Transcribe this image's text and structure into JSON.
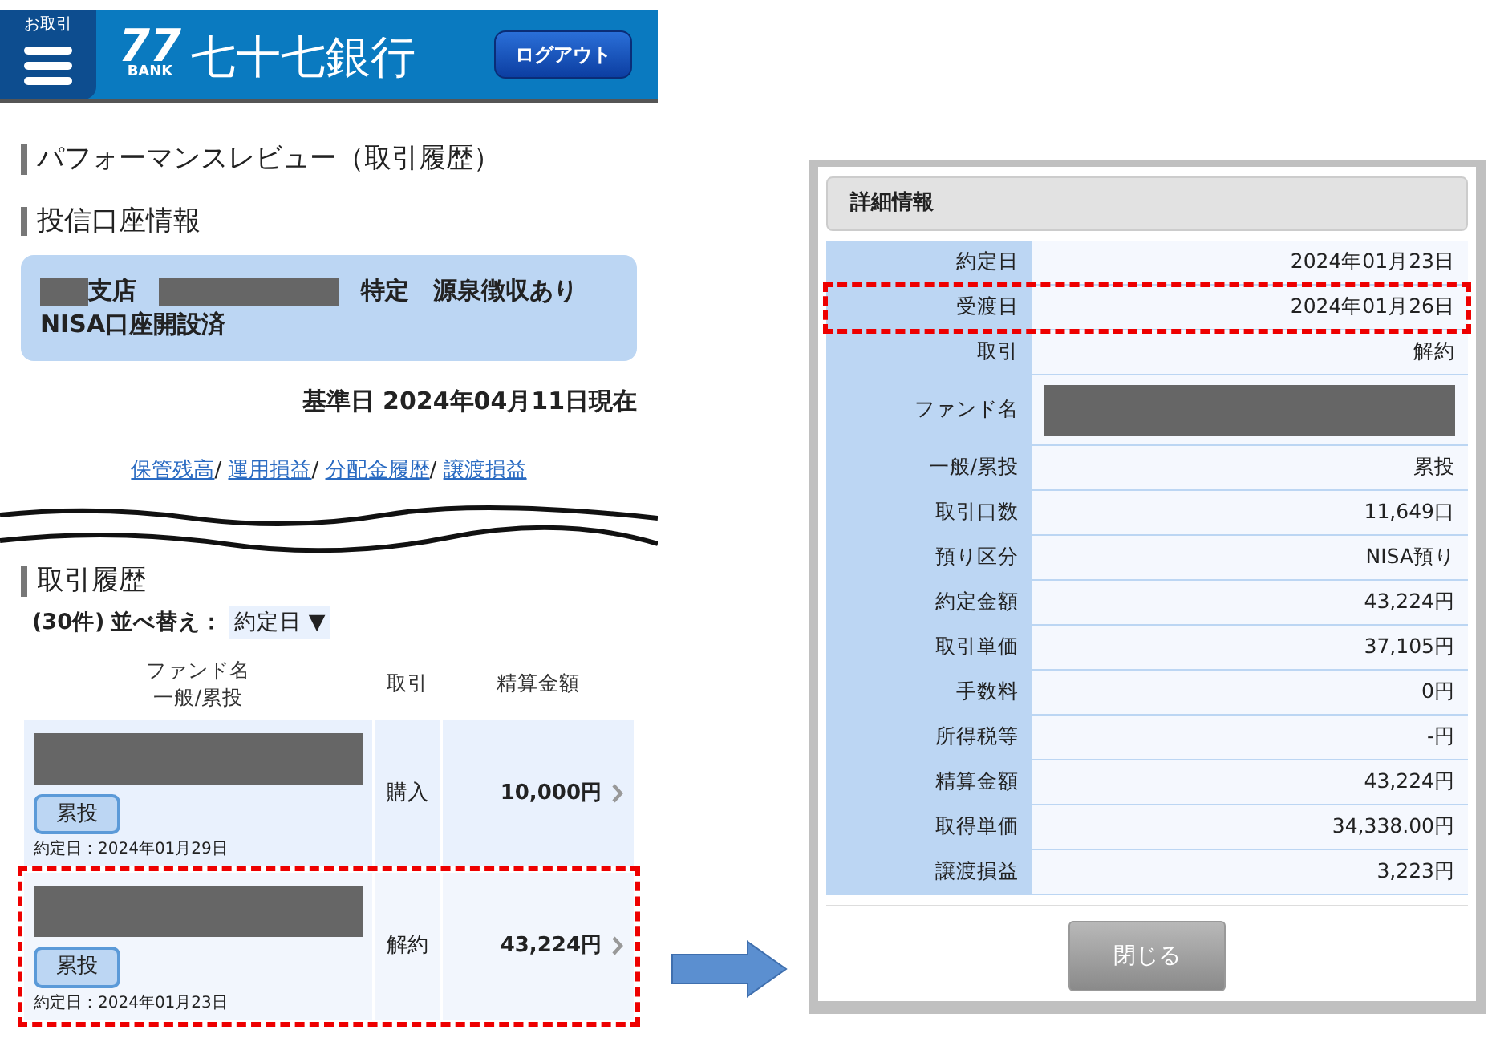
{
  "header": {
    "menu_label": "お取引",
    "logo_number": "77",
    "logo_sub": "BANK",
    "bank_name": "七十七銀行",
    "logout": "ログアウト"
  },
  "page_title": "パフォーマンスレビュー（取引履歴）",
  "account_section": {
    "title": "投信口座情報",
    "branch_suffix": "支店",
    "account_type": "特定　源泉徴収あり",
    "nisa": "NISA口座開設済"
  },
  "base_date": "基準日 2024年04月11日現在",
  "links": [
    {
      "label": "保管残高",
      "separator": "/"
    },
    {
      "label": "運用損益",
      "separator": "/"
    },
    {
      "label": "分配金履歴",
      "separator": "/"
    },
    {
      "label": "譲渡損益"
    }
  ],
  "history": {
    "title": "取引履歴",
    "count": "(30件)",
    "sort_label": "並べ替え：",
    "sort_value": "約定日",
    "sort_caret": "▼",
    "columns": [
      {
        "lines": [
          "ファンド名",
          "一般/累投"
        ]
      },
      {
        "lines": [
          "取引"
        ]
      },
      {
        "lines": [
          "精算金額"
        ]
      }
    ],
    "rows": [
      {
        "tag": "累投",
        "date": "約定日：2024年01月29日",
        "trade": "購入",
        "amount": "10,000円",
        "highlighted": false
      },
      {
        "tag": "累投",
        "date": "約定日：2024年01月23日",
        "trade": "解約",
        "amount": "43,224円",
        "highlighted": true
      }
    ]
  },
  "detail": {
    "title": "詳細情報",
    "close": "閉じる",
    "rows": [
      {
        "label": "約定日",
        "value": "2024年01月23日",
        "highlighted": false
      },
      {
        "label": "受渡日",
        "value": "2024年01月26日",
        "highlighted": true
      },
      {
        "label": "取引",
        "value": "解約",
        "highlighted": false
      },
      {
        "label": "ファンド名",
        "kind": "redacted",
        "highlighted": false
      },
      {
        "label": "一般/累投",
        "value": "累投",
        "highlighted": false
      },
      {
        "label": "取引口数",
        "value": "11,649口",
        "highlighted": false
      },
      {
        "label": "預り区分",
        "value": "NISA預り",
        "highlighted": false
      },
      {
        "label": "約定金額",
        "value": "43,224円",
        "highlighted": false
      },
      {
        "label": "取引単価",
        "value": "37,105円",
        "highlighted": false
      },
      {
        "label": "手数料",
        "value": "0円",
        "highlighted": false
      },
      {
        "label": "所得税等",
        "value": "-円",
        "highlighted": false
      },
      {
        "label": "精算金額",
        "value": "43,224円",
        "highlighted": false
      },
      {
        "label": "取得単価",
        "value": "34,338.00円",
        "highlighted": false
      },
      {
        "label": "譲渡損益",
        "value": "3,223円",
        "highlighted": false
      }
    ]
  }
}
